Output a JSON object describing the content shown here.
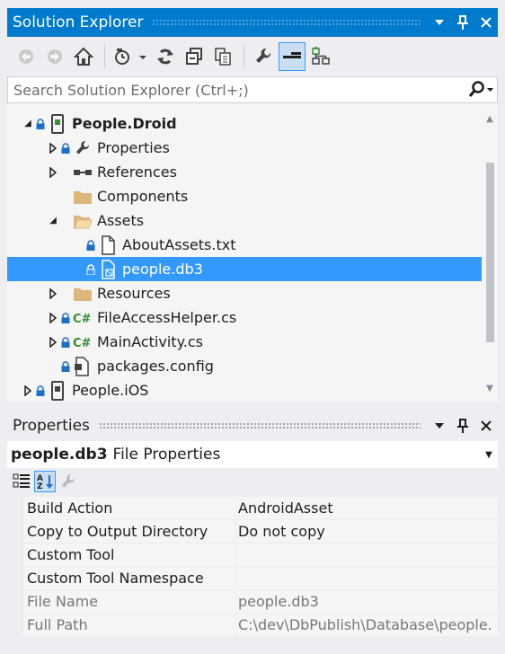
{
  "solution_explorer": {
    "title": "Solution Explorer",
    "search_placeholder": "Search Solution Explorer (Ctrl+;)",
    "tree": [
      {
        "label": "People.Droid",
        "bold": true,
        "icon": "android-project-icon",
        "expand": "expanded"
      },
      {
        "label": "Properties",
        "icon": "wrench-icon",
        "expand": "collapsed"
      },
      {
        "label": "References",
        "icon": "references-icon",
        "expand": "collapsed"
      },
      {
        "label": "Components",
        "icon": "folder-icon",
        "expand": "none"
      },
      {
        "label": "Assets",
        "icon": "open-folder-icon",
        "expand": "expanded"
      },
      {
        "label": "AboutAssets.txt",
        "icon": "text-file-icon",
        "expand": "none"
      },
      {
        "label": "people.db3",
        "icon": "db-file-icon",
        "expand": "none",
        "selected": true
      },
      {
        "label": "Resources",
        "icon": "folder-icon",
        "expand": "collapsed"
      },
      {
        "label": "FileAccessHelper.cs",
        "icon": "csharp-file-icon",
        "expand": "collapsed"
      },
      {
        "label": "MainActivity.cs",
        "icon": "csharp-file-icon",
        "expand": "collapsed"
      },
      {
        "label": "packages.config",
        "icon": "config-file-icon",
        "expand": "none"
      },
      {
        "label": "People.iOS",
        "bold": false,
        "icon": "ios-project-icon",
        "expand": "collapsed"
      }
    ]
  },
  "properties": {
    "title": "Properties",
    "object_name": "people.db3",
    "object_type": "File Properties",
    "rows": [
      {
        "name": "Build Action",
        "value": "AndroidAsset",
        "readonly": false
      },
      {
        "name": "Copy to Output Directory",
        "value": "Do not copy",
        "readonly": false
      },
      {
        "name": "Custom Tool",
        "value": "",
        "readonly": false
      },
      {
        "name": "Custom Tool Namespace",
        "value": "",
        "readonly": false
      },
      {
        "name": "File Name",
        "value": "people.db3",
        "readonly": true
      },
      {
        "name": "Full Path",
        "value": "C:\\dev\\DbPublish\\Database\\people.",
        "readonly": true
      }
    ]
  },
  "colors": {
    "accent": "#007acc",
    "selection": "#3399ff",
    "panel_bg": "#f5f5f5",
    "frame_bg": "#eeeef2"
  }
}
